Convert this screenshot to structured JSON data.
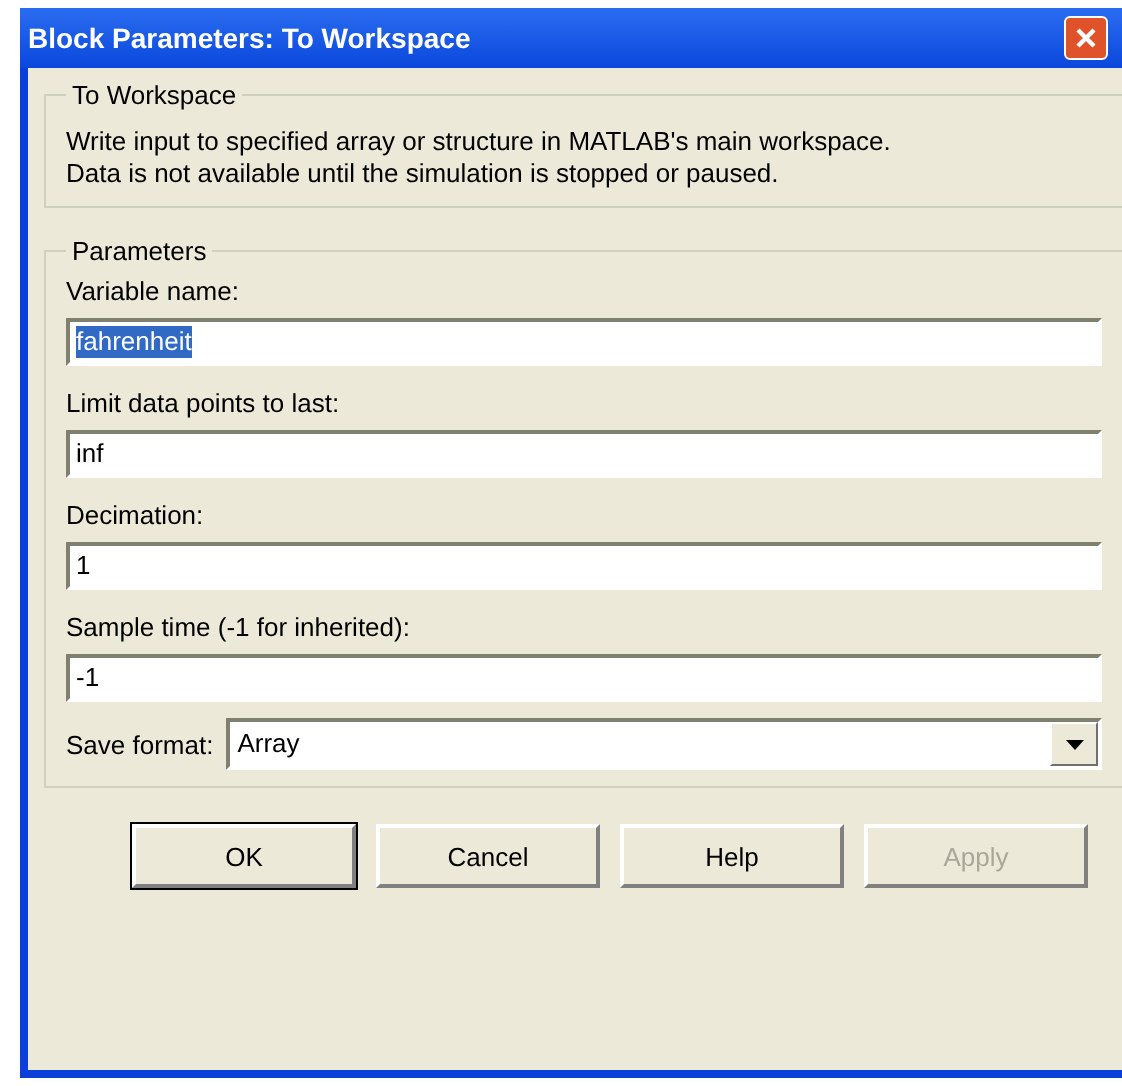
{
  "window": {
    "title": "Block Parameters: To Workspace"
  },
  "description": {
    "legend": "To Workspace",
    "text": "Write input to specified array or structure in MATLAB's main workspace.\nData is not available until the simulation is stopped or paused."
  },
  "parameters": {
    "legend": "Parameters",
    "fields": [
      {
        "label": "Variable name:",
        "value": "fahrenheit",
        "selected": true
      },
      {
        "label": "Limit data points to last:",
        "value": "inf",
        "selected": false
      },
      {
        "label": "Decimation:",
        "value": "1",
        "selected": false
      },
      {
        "label": "Sample time (-1 for inherited):",
        "value": "-1",
        "selected": false
      }
    ],
    "save_format": {
      "label": "Save format:",
      "value": "Array"
    }
  },
  "buttons": [
    {
      "label": "OK",
      "default": true,
      "disabled": false
    },
    {
      "label": "Cancel",
      "default": false,
      "disabled": false
    },
    {
      "label": "Help",
      "default": false,
      "disabled": false
    },
    {
      "label": "Apply",
      "default": false,
      "disabled": true
    }
  ]
}
